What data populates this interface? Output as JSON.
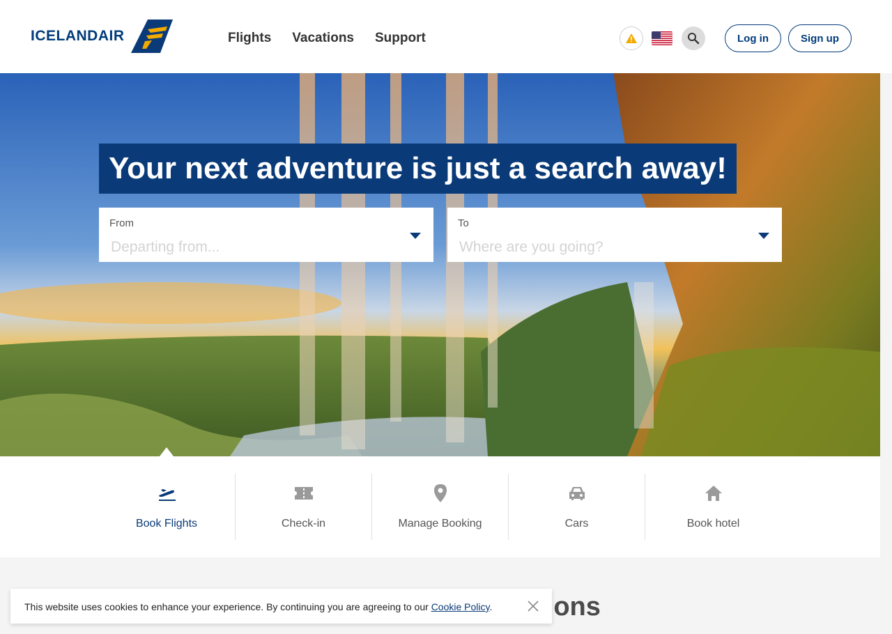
{
  "header": {
    "logo_text": "ICELANDAIR",
    "nav": [
      "Flights",
      "Vacations",
      "Support"
    ],
    "icons": {
      "alert": "warning-icon",
      "language": "us-flag-icon",
      "search": "search-icon"
    },
    "login_label": "Log in",
    "signup_label": "Sign up"
  },
  "hero": {
    "headline": "Your next adventure is just a search away!",
    "from_label": "From",
    "from_placeholder": "Departing from...",
    "to_label": "To",
    "to_placeholder": "Where are you going?"
  },
  "quick_links": [
    {
      "label": "Book Flights",
      "icon": "plane-departure-icon",
      "active": true
    },
    {
      "label": "Check-in",
      "icon": "ticket-icon",
      "active": false
    },
    {
      "label": "Manage Booking",
      "icon": "location-pin-icon",
      "active": false
    },
    {
      "label": "Cars",
      "icon": "car-icon",
      "active": false
    },
    {
      "label": "Book hotel",
      "icon": "home-icon",
      "active": false
    }
  ],
  "section_title_partial": "ations",
  "cookie": {
    "text": "This website uses cookies to enhance your experience. By continuing you are agreeing to our ",
    "link": "Cookie Policy",
    "suffix": "."
  },
  "colors": {
    "brand": "#0a3a78",
    "accent": "#f2a900",
    "active_link": "#0a3a78"
  }
}
